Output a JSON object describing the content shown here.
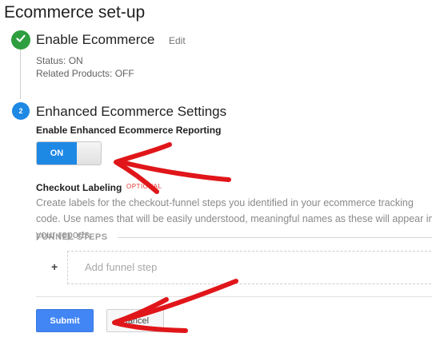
{
  "page": {
    "title": "Ecommerce set-up"
  },
  "step1": {
    "title": "Enable Ecommerce",
    "edit_label": "Edit",
    "status": "Status: ON",
    "related_products": "Related Products: OFF",
    "icon": "check-icon"
  },
  "step2": {
    "number": "2",
    "title": "Enhanced Ecommerce Settings",
    "reporting_label": "Enable Enhanced Ecommerce Reporting",
    "toggle_label": "ON",
    "toggle_state": "on",
    "checkout_label": "Checkout Labeling",
    "optional_tag": "OPTIONAL",
    "help_text": "Create labels for the checkout-funnel steps you identified in your ecommerce tracking code. Use names that will be easily understood, meaningful names as these will appear in your reports.",
    "funnel_header": "FUNNEL STEPS",
    "plus": "+",
    "add_step_placeholder": "Add funnel step"
  },
  "footer": {
    "submit_label": "Submit",
    "cancel_label": "Cancel"
  },
  "colors": {
    "accent_blue": "#1e88e5",
    "success_green": "#2e9e3f",
    "annotation_red": "#e0161a"
  }
}
